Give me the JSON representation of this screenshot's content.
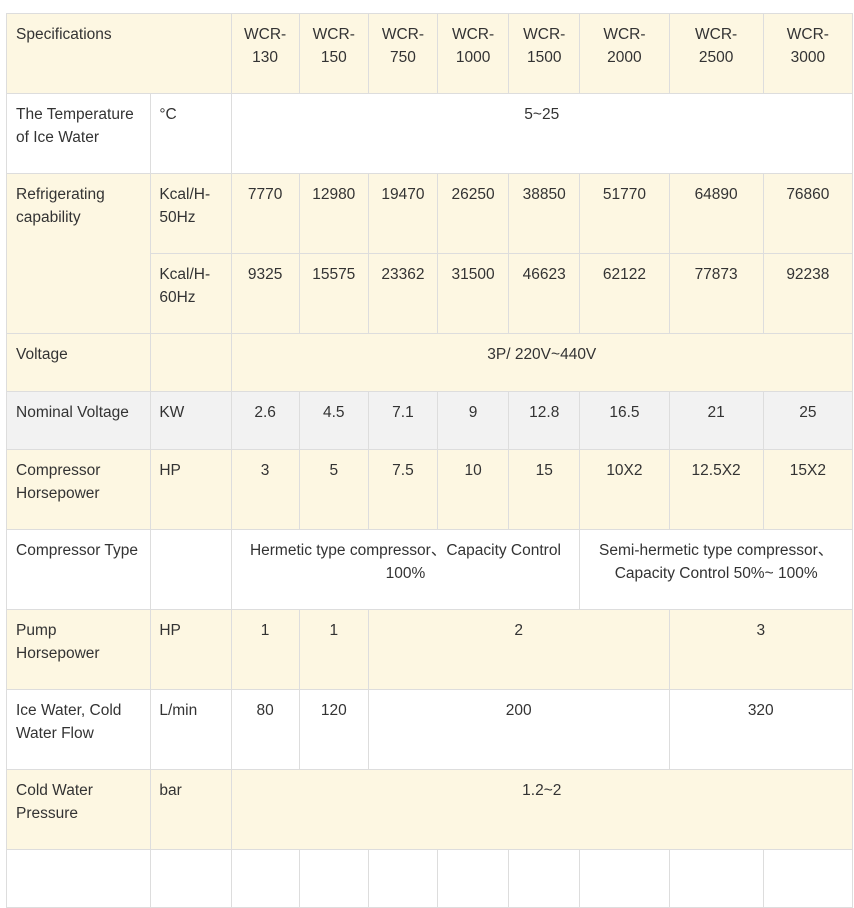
{
  "table": {
    "header": {
      "label": "Specifications",
      "models": [
        "WCR-\n130",
        "WCR-\n150",
        "WCR-\n750",
        "WCR-\n1000",
        "WCR-\n1500",
        "WCR-\n2000",
        "WCR-\n2500",
        "WCR-\n3000"
      ]
    },
    "ice_water_temp": {
      "label": "The Temperature of Ice Water",
      "unit": "°C",
      "value": "5~25"
    },
    "refrigerating": {
      "label": "Refrigerating capability",
      "unit_50": "Kcal/H-50Hz",
      "values_50": [
        "7770",
        "12980",
        "19470",
        "26250",
        "38850",
        "51770",
        "64890",
        "76860"
      ],
      "unit_60": "Kcal/H-60Hz",
      "values_60": [
        "9325",
        "15575",
        "23362",
        "31500",
        "46623",
        "62122",
        "77873",
        "92238"
      ]
    },
    "voltage": {
      "label": "Voltage",
      "value": "3P/ 220V~440V"
    },
    "nominal_voltage": {
      "label": "Nominal Voltage",
      "unit": "KW",
      "values": [
        "2.6",
        "4.5",
        "7.1",
        "9",
        "12.8",
        "16.5",
        "21",
        "25"
      ]
    },
    "compressor_hp": {
      "label": "Compressor Horsepower",
      "unit": "HP",
      "values": [
        "3",
        "5",
        "7.5",
        "10",
        "15",
        "10X2",
        "12.5X2",
        "15X2"
      ]
    },
    "compressor_type": {
      "label": "Compressor Type",
      "hermetic": "Hermetic type compressor、Capacity Control 100%",
      "semi_hermetic": "Semi-hermetic type compressor、Capacity Control 50%~ 100%"
    },
    "pump_hp": {
      "label": "Pump Horsepower",
      "unit": "HP",
      "values": [
        "1",
        "1",
        "2",
        "3"
      ]
    },
    "water_flow": {
      "label": "Ice Water, Cold Water Flow",
      "unit": "L/min",
      "values": [
        "80",
        "120",
        "200",
        "320"
      ]
    },
    "cold_water_pressure": {
      "label": "Cold Water Pressure",
      "unit": "bar",
      "value": "1.2~2"
    }
  }
}
